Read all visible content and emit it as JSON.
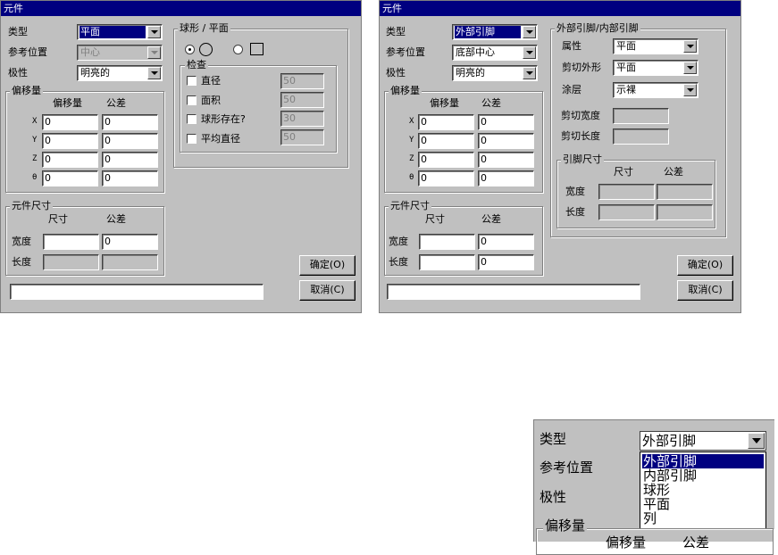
{
  "left_dialog": {
    "title": "元件",
    "type_label": "类型",
    "type_value": "平面",
    "ref_label": "参考位置",
    "ref_value": "中心",
    "polarity_label": "极性",
    "polarity_value": "明亮的",
    "offset_group": "偏移量",
    "offset_col": "偏移量",
    "tolerance_col": "公差",
    "axes": [
      "X",
      "Y",
      "Z",
      "θ"
    ],
    "offset_values": [
      "0",
      "0",
      "0",
      "0"
    ],
    "tolerance_values": [
      "0",
      "0",
      "0",
      "0"
    ],
    "size_group": "元件尺寸",
    "size_col": "尺寸",
    "size_tol_col": "公差",
    "width_label": "宽度",
    "length_label": "长度",
    "width_value": "",
    "width_tol": "0",
    "shape_group": "球形 / 平面",
    "check_group": "检查",
    "checks": [
      {
        "label": "直径",
        "value": "50"
      },
      {
        "label": "面积",
        "value": "50"
      },
      {
        "label": "球形存在?",
        "value": "30"
      },
      {
        "label": "平均直径",
        "value": "50"
      }
    ],
    "ok_label": "确定(O)",
    "cancel_label": "取消(C)"
  },
  "right_dialog": {
    "title": "元件",
    "type_label": "类型",
    "type_value": "外部引脚",
    "ref_label": "参考位置",
    "ref_value": "底部中心",
    "polarity_label": "极性",
    "polarity_value": "明亮的",
    "offset_group": "偏移量",
    "offset_col": "偏移量",
    "tolerance_col": "公差",
    "axes": [
      "X",
      "Y",
      "Z",
      "θ"
    ],
    "offset_values": [
      "0",
      "0",
      "0",
      "0"
    ],
    "tolerance_values": [
      "0",
      "0",
      "0",
      "0"
    ],
    "size_group": "元件尺寸",
    "size_col": "尺寸",
    "size_tol_col": "公差",
    "width_label": "宽度",
    "length_label": "长度",
    "width_tol": "0",
    "length_tol": "0",
    "lead_group": "外部引脚/内部引脚",
    "attr_label": "属性",
    "attr_value": "平面",
    "cut_shape_label": "剪切外形",
    "cut_shape_value": "平面",
    "coating_label": "涂层",
    "coating_value": "示裸",
    "cut_width_label": "剪切宽度",
    "cut_length_label": "剪切长度",
    "pin_size_group": "引脚尺寸",
    "pin_size_col": "尺寸",
    "pin_tol_col": "公差",
    "pin_width_label": "宽度",
    "pin_length_label": "长度",
    "ok_label": "确定(O)",
    "cancel_label": "取消(C)"
  },
  "zoom_panel": {
    "type_label": "类型",
    "type_value": "外部引脚",
    "ref_label": "参考位置",
    "polarity_label": "极性",
    "offset_group": "偏移量",
    "offset_col_partial": "偏移量",
    "tolerance_col_partial": "公差",
    "options": [
      "外部引脚",
      "内部引脚",
      "球形",
      "平面",
      "列"
    ]
  }
}
